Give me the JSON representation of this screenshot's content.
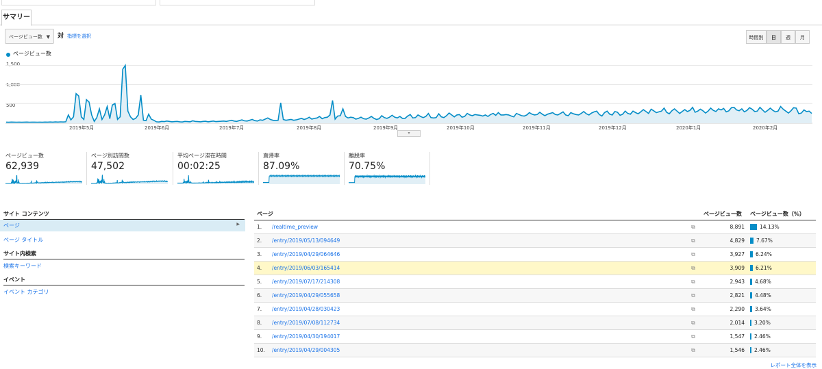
{
  "tabs": {
    "summary": "サマリー"
  },
  "controls": {
    "metric": "ページビュー数",
    "vs": "対",
    "select_metric": "指標を選択",
    "granularity": [
      "時間別",
      "日",
      "週",
      "月"
    ]
  },
  "chart_data": {
    "type": "area",
    "series": [
      {
        "name": "ページビュー数",
        "values": [
          10,
          8,
          12,
          10,
          9,
          11,
          8,
          10,
          12,
          9,
          10,
          11,
          9,
          10,
          8,
          12,
          11,
          14,
          10,
          16,
          12,
          18,
          14,
          20,
          200,
          70,
          150,
          760,
          700,
          150,
          80,
          600,
          540,
          200,
          30,
          130,
          360,
          80,
          200,
          420,
          100,
          460,
          500,
          80,
          150,
          1400,
          1500,
          300,
          150,
          80,
          110,
          200,
          720,
          60,
          50,
          220,
          90,
          60,
          20,
          15,
          30,
          25,
          40,
          30,
          20,
          25,
          30,
          20,
          15,
          30,
          25,
          20,
          45,
          30,
          25,
          20,
          30,
          35,
          20,
          30,
          40,
          25,
          30,
          35,
          40,
          30,
          45,
          60,
          40,
          30,
          50,
          70,
          45,
          40,
          60,
          80,
          50,
          40,
          70,
          60,
          90,
          120,
          80,
          60,
          50,
          60,
          520,
          80,
          60,
          70,
          80,
          60,
          70,
          90,
          110,
          80,
          100,
          140,
          90,
          110,
          120,
          160,
          100,
          130,
          140,
          200,
          580,
          90,
          170,
          180,
          360,
          160,
          120,
          140,
          130,
          90,
          110,
          140,
          100,
          90,
          120,
          160,
          110,
          80,
          100,
          180,
          130,
          110,
          140,
          190,
          140,
          120,
          160,
          110,
          110,
          170,
          210,
          120,
          130,
          200,
          160,
          130,
          160,
          240,
          130,
          120,
          130,
          230,
          150,
          130,
          180,
          250,
          200,
          150,
          200,
          210,
          140,
          160,
          240,
          200,
          180,
          210,
          200,
          190,
          170,
          200,
          160,
          210,
          240,
          190,
          260,
          200,
          200,
          210,
          200,
          170,
          150,
          240,
          210,
          180,
          170,
          200,
          260,
          220,
          200,
          210,
          270,
          220,
          180,
          220,
          240,
          260,
          210,
          200,
          240,
          280,
          200,
          180,
          260,
          230,
          210,
          200,
          240,
          290,
          230,
          200,
          250,
          280,
          300,
          210,
          170,
          260,
          300,
          220,
          200,
          290,
          270,
          190,
          220,
          300,
          240,
          220,
          300,
          260,
          230,
          280,
          340,
          290,
          240,
          350,
          310,
          260,
          280,
          300,
          380,
          270,
          230,
          310,
          360,
          300,
          240,
          290,
          340,
          290,
          320,
          400,
          270,
          300,
          350,
          310,
          250,
          300,
          380,
          320,
          290,
          360,
          330,
          370,
          280,
          310,
          390,
          400,
          330,
          310,
          360,
          280,
          320,
          390,
          350,
          290,
          300,
          400,
          330,
          270,
          320,
          380,
          320,
          280,
          300,
          420,
          350,
          300,
          250,
          310,
          390,
          380,
          230,
          250,
          330,
          290,
          300,
          240
        ]
      }
    ],
    "ylim": [
      0,
      1600
    ],
    "yticks": [
      {
        "value": 1500,
        "label": "1,500"
      },
      {
        "value": 1000,
        "label": "1,000"
      },
      {
        "value": 500,
        "label": "500"
      }
    ],
    "xtick_labels": [
      "2019年5月",
      "2019年6月",
      "2019年7月",
      "2019年8月",
      "2019年9月",
      "2019年10月",
      "2019年11月",
      "2019年12月",
      "2020年1月",
      "2020年2月"
    ],
    "legend": "top-left",
    "grid": true,
    "color": "#058dc7"
  },
  "scorecards": [
    {
      "label": "ページビュー数",
      "value": "62,939"
    },
    {
      "label": "ページ別訪問数",
      "value": "47,502"
    },
    {
      "label": "平均ページ滞在時間",
      "value": "00:02:25"
    },
    {
      "label": "直帰率",
      "value": "87.09%"
    },
    {
      "label": "離脱率",
      "value": "70.75%"
    }
  ],
  "sidebar": {
    "site_content": "サイト コンテンツ",
    "page": "ページ",
    "page_title": "ページ タイトル",
    "site_search": "サイト内検索",
    "search_keyword": "検索キーワード",
    "events": "イベント",
    "event_category": "イベント カテゴリ"
  },
  "table": {
    "col_page": "ページ",
    "col_pv": "ページビュー数",
    "col_pct": "ページビュー数（%）",
    "rows": [
      {
        "num": "1.",
        "page": "/realtime_preview",
        "pv": "8,891",
        "pct": "14.13%",
        "frac": 0.1413
      },
      {
        "num": "2.",
        "page": "/entry/2019/05/13/094649",
        "pv": "4,829",
        "pct": "7.67%",
        "frac": 0.0767
      },
      {
        "num": "3.",
        "page": "/entry/2019/04/29/064646",
        "pv": "3,927",
        "pct": "6.24%",
        "frac": 0.0624
      },
      {
        "num": "4.",
        "page": "/entry/2019/06/03/165414",
        "pv": "3,909",
        "pct": "6.21%",
        "frac": 0.0621
      },
      {
        "num": "5.",
        "page": "/entry/2019/07/17/214308",
        "pv": "2,943",
        "pct": "4.68%",
        "frac": 0.0468
      },
      {
        "num": "6.",
        "page": "/entry/2019/04/29/055658",
        "pv": "2,821",
        "pct": "4.48%",
        "frac": 0.0448
      },
      {
        "num": "7.",
        "page": "/entry/2019/04/28/030423",
        "pv": "2,290",
        "pct": "3.64%",
        "frac": 0.0364
      },
      {
        "num": "8.",
        "page": "/entry/2019/07/08/112734",
        "pv": "2,014",
        "pct": "3.20%",
        "frac": 0.032
      },
      {
        "num": "9.",
        "page": "/entry/2019/04/30/194017",
        "pv": "1,547",
        "pct": "2.46%",
        "frac": 0.0246
      },
      {
        "num": "10.",
        "page": "/entry/2019/04/29/004305",
        "pv": "1,546",
        "pct": "2.46%",
        "frac": 0.0246
      }
    ]
  },
  "report_link": "レポート全体を表示"
}
